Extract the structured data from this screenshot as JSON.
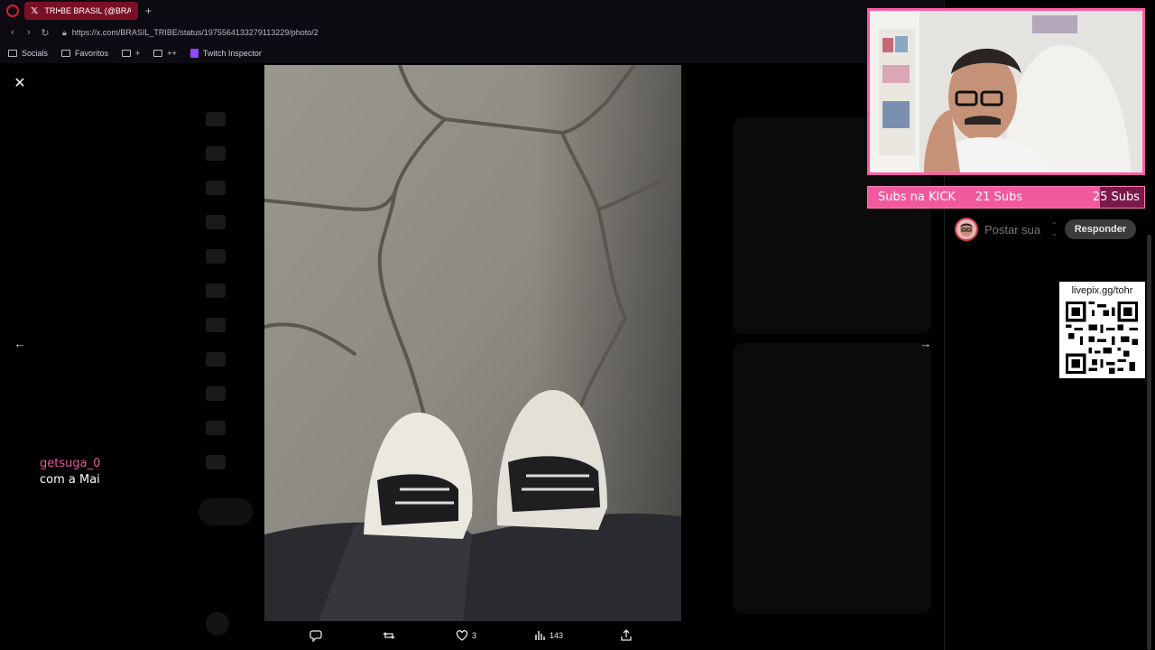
{
  "browser": {
    "tab_title": "TRI•BE BRASIL (@BRASIL",
    "new_tab_glyph": "+",
    "url": "https://x.com/BRASIL_TRIBE/status/1975564133279113229/photo/2"
  },
  "bookmarks": [
    {
      "label": "Socials",
      "icon": "folder-icon"
    },
    {
      "label": "Favoritos",
      "icon": "folder-icon"
    },
    {
      "label": "+",
      "icon": "folder-icon"
    },
    {
      "label": "++",
      "icon": "folder-icon"
    },
    {
      "label": "Twitch Inspector",
      "icon": "twitch-icon"
    }
  ],
  "viewer": {
    "close_glyph": "✕",
    "prev_glyph": "←",
    "next_glyph": "→",
    "actions": {
      "reply_count": "",
      "repost_count": "",
      "like_count": "3",
      "views_count": "143"
    }
  },
  "overlay": {
    "chat": {
      "username": "getsuga_0",
      "message": "com a Mai"
    },
    "subs": {
      "title": "Subs na KICK",
      "current": "21 Subs",
      "goal": "25 Subs",
      "progress": 0.84
    },
    "reply": {
      "placeholder": "Postar sua",
      "button": "Responder"
    },
    "qr": {
      "label": "livepix.gg/tohr"
    }
  },
  "colors": {
    "accent_pink": "#f2599c",
    "tab_red": "#7a1026",
    "twitch_purple": "#9146ff"
  }
}
